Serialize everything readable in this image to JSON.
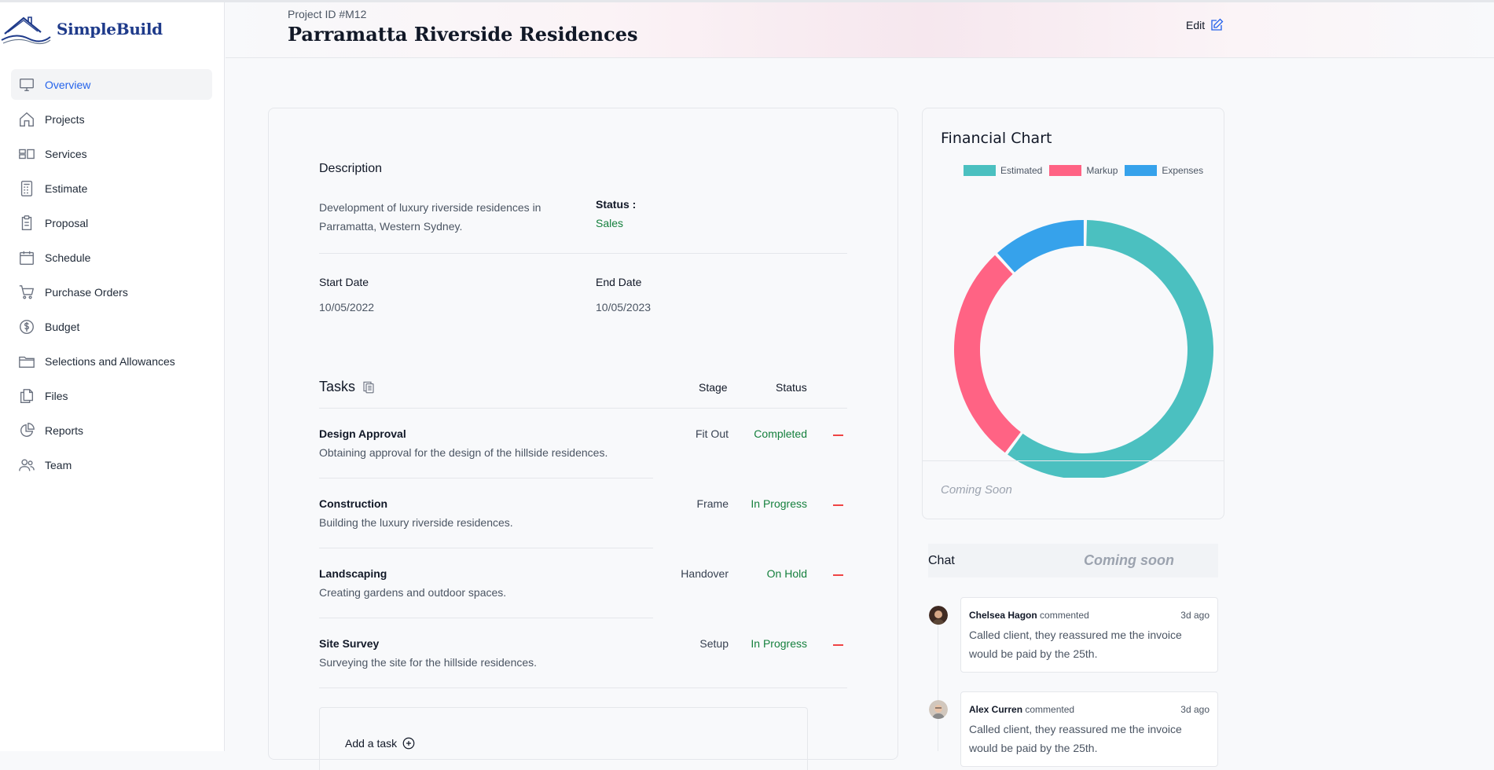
{
  "app": {
    "name": "SimpleBuild"
  },
  "sidebar": {
    "items": [
      {
        "label": "Overview",
        "icon": "monitor-icon",
        "active": true
      },
      {
        "label": "Projects",
        "icon": "home-icon"
      },
      {
        "label": "Services",
        "icon": "layout-icon"
      },
      {
        "label": "Estimate",
        "icon": "calculator-icon"
      },
      {
        "label": "Proposal",
        "icon": "clipboard-icon"
      },
      {
        "label": "Schedule",
        "icon": "calendar-icon"
      },
      {
        "label": "Purchase Orders",
        "icon": "cart-icon"
      },
      {
        "label": "Budget",
        "icon": "dollar-icon"
      },
      {
        "label": "Selections and Allowances",
        "icon": "folder-icon"
      },
      {
        "label": "Files",
        "icon": "files-icon"
      },
      {
        "label": "Reports",
        "icon": "pie-icon"
      },
      {
        "label": "Team",
        "icon": "users-icon"
      }
    ]
  },
  "header": {
    "project_id": "Project ID #M12",
    "title": "Parramatta Riverside Residences",
    "edit_label": "Edit"
  },
  "overview": {
    "description_title": "Description",
    "description_text": "Development of luxury riverside residences in Parramatta, Western Sydney.",
    "status_label": "Status :",
    "status_value": "Sales",
    "start_date_label": "Start Date",
    "start_date_value": "10/05/2022",
    "end_date_label": "End Date",
    "end_date_value": "10/05/2023"
  },
  "tasks": {
    "title": "Tasks",
    "col_stage": "Stage",
    "col_status": "Status",
    "add_label": "Add a task",
    "items": [
      {
        "name": "Design Approval",
        "desc": "Obtaining approval for the design of the hillside residences.",
        "stage": "Fit Out",
        "status": "Completed"
      },
      {
        "name": "Construction",
        "desc": "Building the luxury riverside residences.",
        "stage": "Frame",
        "status": "In Progress"
      },
      {
        "name": "Landscaping",
        "desc": "Creating gardens and outdoor spaces.",
        "stage": "Handover",
        "status": "On Hold"
      },
      {
        "name": "Site Survey",
        "desc": "Surveying the site for the hillside residences.",
        "stage": "Setup",
        "status": "In Progress"
      }
    ]
  },
  "financial": {
    "title": "Financial Chart",
    "footer": "Coming Soon"
  },
  "chart_data": {
    "type": "pie",
    "title": "Financial Chart",
    "categories": [
      "Estimated",
      "Markup",
      "Expenses"
    ],
    "values": [
      60,
      28,
      12
    ],
    "colors": [
      "#4bc0c0",
      "#ff6384",
      "#36a2eb"
    ],
    "legend": "top"
  },
  "chat": {
    "title": "Chat",
    "coming_soon": "Coming soon",
    "comments": [
      {
        "author": "Chelsea Hagon",
        "action": "commented",
        "time": "3d ago",
        "text": "Called client, they reassured me the invoice would be paid by the 25th."
      },
      {
        "author": "Alex Curren",
        "action": "commented",
        "time": "3d ago",
        "text": "Called client, they reassured me the invoice would be paid by the 25th."
      }
    ]
  }
}
